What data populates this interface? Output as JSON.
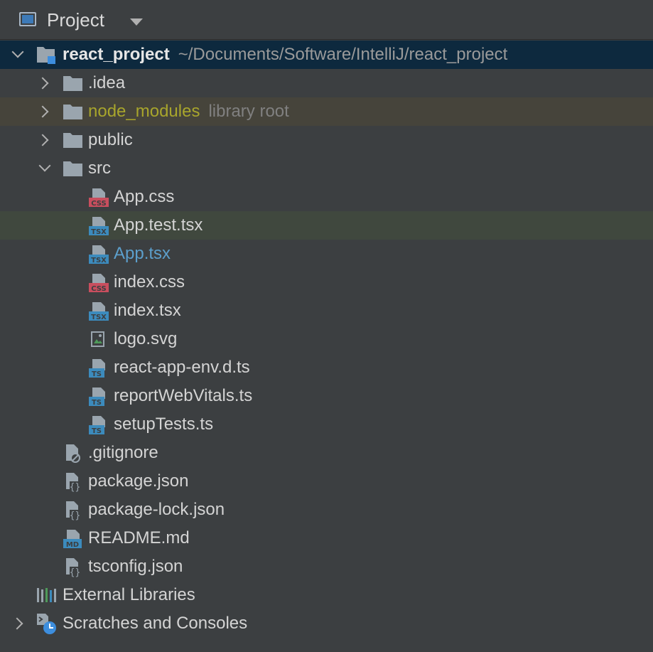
{
  "toolbar": {
    "title": "Project"
  },
  "root": {
    "name": "react_project",
    "path": "~/Documents/Software/IntelliJ/react_project"
  },
  "items": {
    "idea": ".idea",
    "node_modules": "node_modules",
    "node_modules_hint": "library root",
    "public": "public",
    "src": "src",
    "app_css": "App.css",
    "app_test": "App.test.tsx",
    "app_tsx": "App.tsx",
    "index_css": "index.css",
    "index_tsx": "index.tsx",
    "logo": "logo.svg",
    "react_env": "react-app-env.d.ts",
    "report": "reportWebVitals.ts",
    "setup": "setupTests.ts",
    "gitignore": ".gitignore",
    "package": "package.json",
    "package_lock": "package-lock.json",
    "readme": "README.md",
    "tsconfig": "tsconfig.json",
    "ext_libs": "External Libraries",
    "scratches": "Scratches and Consoles"
  },
  "badges": {
    "css": "CSS",
    "tsx": "TSX",
    "ts": "TS",
    "md": "MD"
  },
  "colors": {
    "background": "#3c3f41",
    "root_selection": "#0d293e",
    "library_row": "#46443b",
    "hover_row": "#40483e",
    "library_text": "#a8a52c",
    "modified_text": "#5c9fcc",
    "css_badge": "#c94e5e",
    "ts_badge": "#3c8bbd"
  }
}
